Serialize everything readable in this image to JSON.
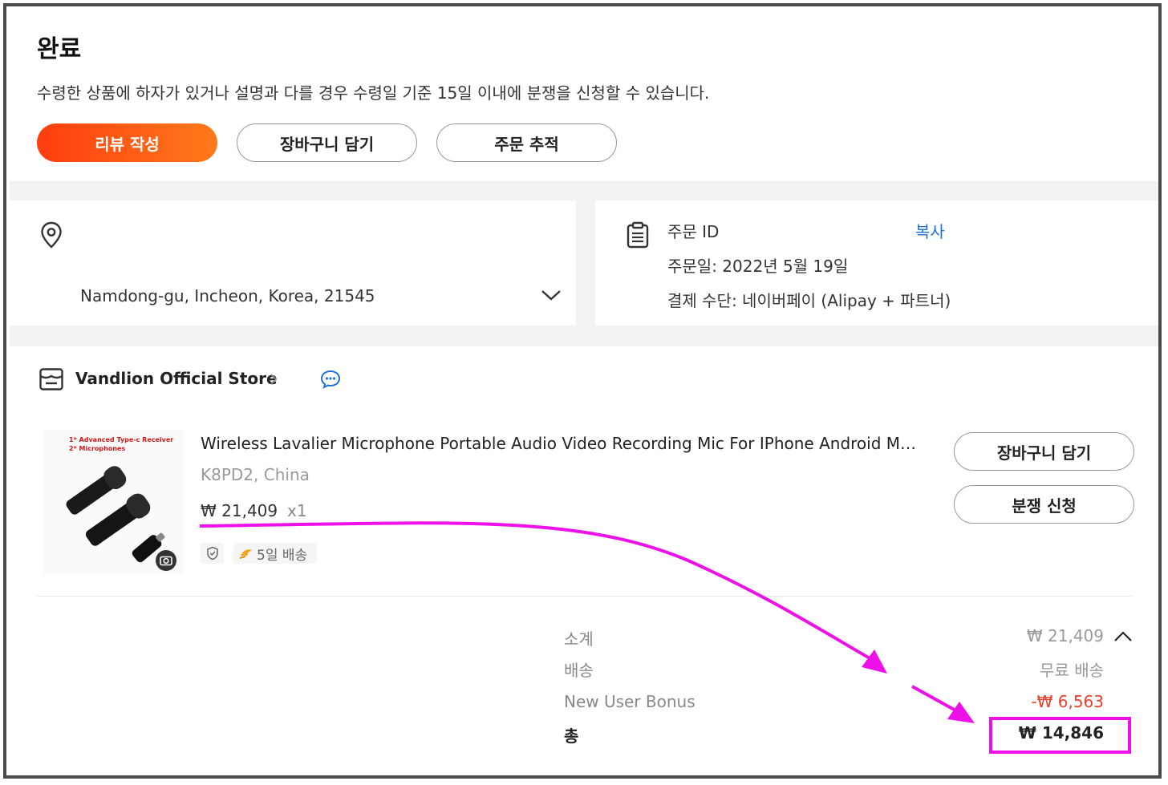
{
  "status": {
    "title": "완료",
    "description": "수령한 상품에 하자가 있거나 설명과 다를 경우 수령일 기준 15일 이내에 분쟁을 신청할 수 있습니다."
  },
  "actions": {
    "review_label": "리뷰 작성",
    "cart_label": "장바구니 담기",
    "track_label": "주문 추적"
  },
  "address": {
    "line": "Namdong-gu, Incheon, Korea, 21545"
  },
  "order_info": {
    "id_label": "주문 ID",
    "copy_label": "복사",
    "date_text": "주문일: 2022년 5월 19일",
    "payment_text": "결제 수단: 네이버페이 (Alipay + 파트너)"
  },
  "store": {
    "name": "Vandlion Official Store"
  },
  "product": {
    "image_caption_1": "1* Advanced Type-c Receiver",
    "image_caption_2": "2* Microphones",
    "title": "Wireless Lavalier Microphone Portable Audio Video Recording Mic For IPhone Android Mo...",
    "variant": "K8PD2, China",
    "price": "₩ 21,409",
    "quantity": "x1",
    "shipping_tag": "5일 배송",
    "cart_button_label": "장바구니 담기",
    "dispute_button_label": "분쟁 신청"
  },
  "summary": {
    "subtotal_label": "소계",
    "subtotal_value": "₩ 21,409",
    "shipping_label": "배송",
    "shipping_value": "무료 배송",
    "bonus_label": "New User Bonus",
    "bonus_value": "-₩ 6,563",
    "total_label": "총",
    "total_value": "₩ 14,846"
  },
  "colors": {
    "accent_orange": "#ff5a14",
    "link_blue": "#1e6fd9",
    "discount_red": "#e8412c",
    "annotation_magenta": "#ee10e8"
  }
}
